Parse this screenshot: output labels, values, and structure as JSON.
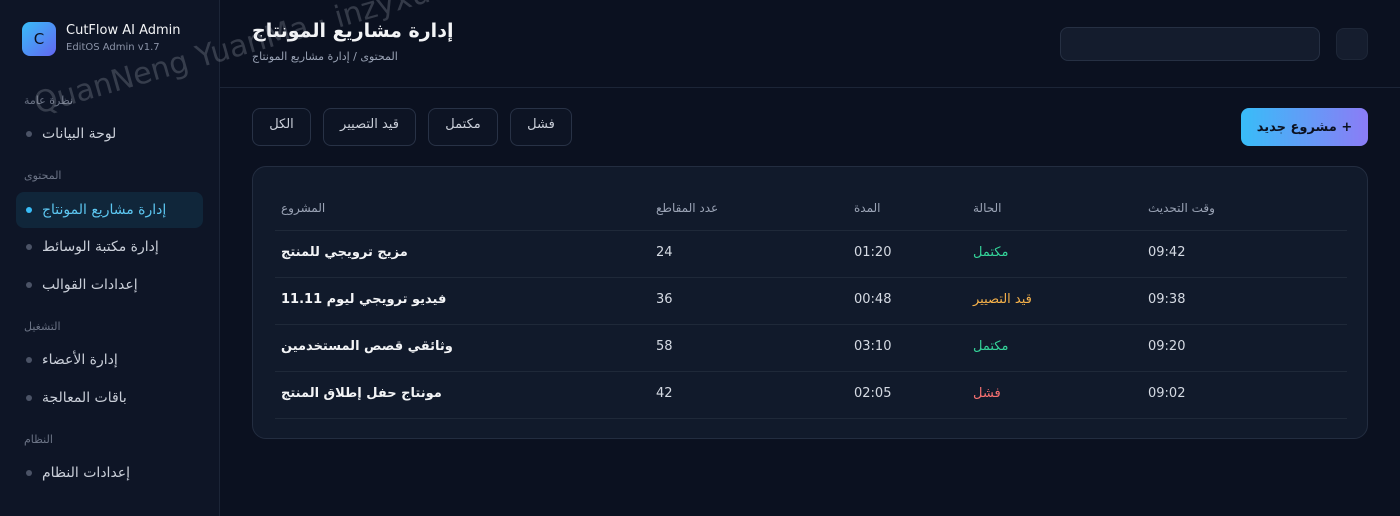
{
  "brand": {
    "logo_letter": "C",
    "title": "CutFlow AI Admin",
    "subtitle": "EditOS Admin v1.7"
  },
  "sidebar": {
    "sections": [
      {
        "label": "نظرة عامة"
      },
      {
        "label": "المحتوى"
      },
      {
        "label": "التشغيل"
      },
      {
        "label": "النظام"
      }
    ],
    "items": [
      {
        "label": "لوحة البيانات"
      },
      {
        "label": "إدارة مشاريع المونتاج",
        "active": true
      },
      {
        "label": "إدارة مكتبة الوسائط"
      },
      {
        "label": "إعدادات القوالب"
      },
      {
        "label": "إدارة الأعضاء"
      },
      {
        "label": "باقات المعالجة"
      },
      {
        "label": "إعدادات النظام"
      }
    ]
  },
  "header": {
    "title": "إدارة مشاريع المونتاج",
    "breadcrumb": "المحتوى / إدارة مشاريع المونتاج"
  },
  "toolbar": {
    "new_button": "مشروع جديد +",
    "filters": [
      "الكل",
      "قيد التصيير",
      "مكتمل",
      "فشل"
    ]
  },
  "table": {
    "headers": {
      "project": "المشروع",
      "clips": "عدد المقاطع",
      "duration": "المدة",
      "status": "الحالة",
      "updated": "وقت التحديث"
    },
    "rows": [
      {
        "project": "مزيج ترويجي للمنتج",
        "clips": "24",
        "duration": "01:20",
        "status": "مكتمل",
        "updated": "09:42"
      },
      {
        "project": "فيديو ترويجي ليوم 11.11",
        "clips": "36",
        "duration": "00:48",
        "status": "قيد التصيير",
        "updated": "09:38"
      },
      {
        "project": "وثائقي قصص المستخدمين",
        "clips": "58",
        "duration": "03:10",
        "status": "مكتمل",
        "updated": "09:20"
      },
      {
        "project": "مونتاج حفل إطلاق المنتج",
        "clips": "42",
        "duration": "02:05",
        "status": "فشل",
        "updated": "09:02"
      }
    ]
  },
  "watermark": "QuanNeng YuanMa · inzyxuashop.com",
  "colors": {
    "accent": "#38bdf8",
    "done": "#34d399",
    "rendering": "#f5b14a",
    "failed": "#f87171"
  }
}
